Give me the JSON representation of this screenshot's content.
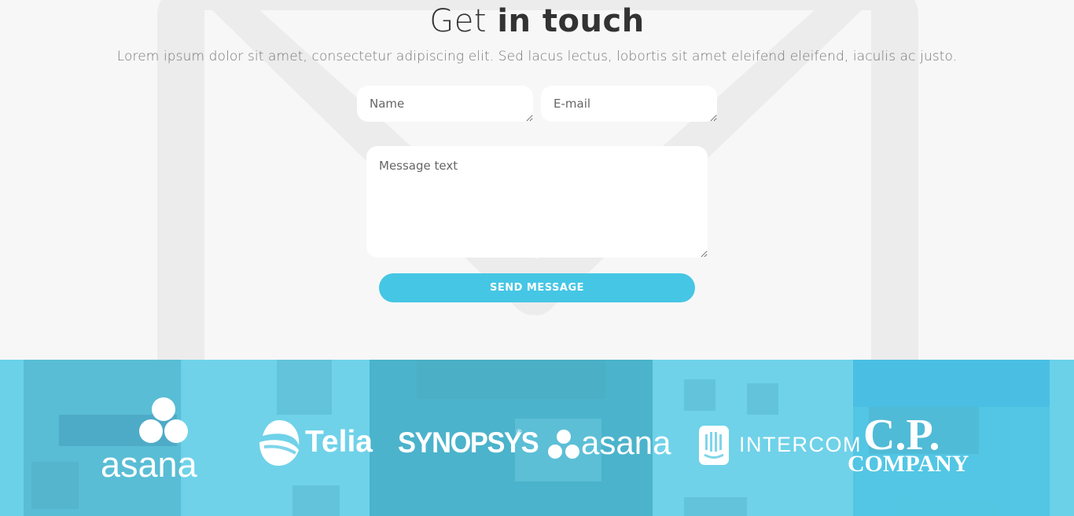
{
  "contact": {
    "title_light": "Get",
    "title_bold": "in touch",
    "subtitle": "Lorem ipsum dolor sit amet, consectetur adipiscing elit. Sed lacus lectus, lobortis sit amet eleifend eleifend, iaculis ac justo.",
    "name_placeholder": "Name",
    "email_placeholder": "E-mail",
    "message_placeholder": "Message text",
    "send_label": "SEND MESSAGE"
  },
  "partners": {
    "logos": [
      {
        "name": "asana",
        "icon": "asana-dots-icon"
      },
      {
        "name": "Telia",
        "icon": "telia-sphere-icon"
      },
      {
        "name": "SYNOPSYS",
        "icon": "registered-mark"
      },
      {
        "name": "asana",
        "icon": "asana-dots-icon"
      },
      {
        "name": "INTERCOM",
        "icon": "intercom-icon"
      },
      {
        "name": "C.P.",
        "sub": "COMPANY",
        "icon": ""
      }
    ],
    "band_color": "#59cee8"
  },
  "colors": {
    "accent": "#45c6e5",
    "background": "#f7f7f7",
    "text": "#333333"
  }
}
